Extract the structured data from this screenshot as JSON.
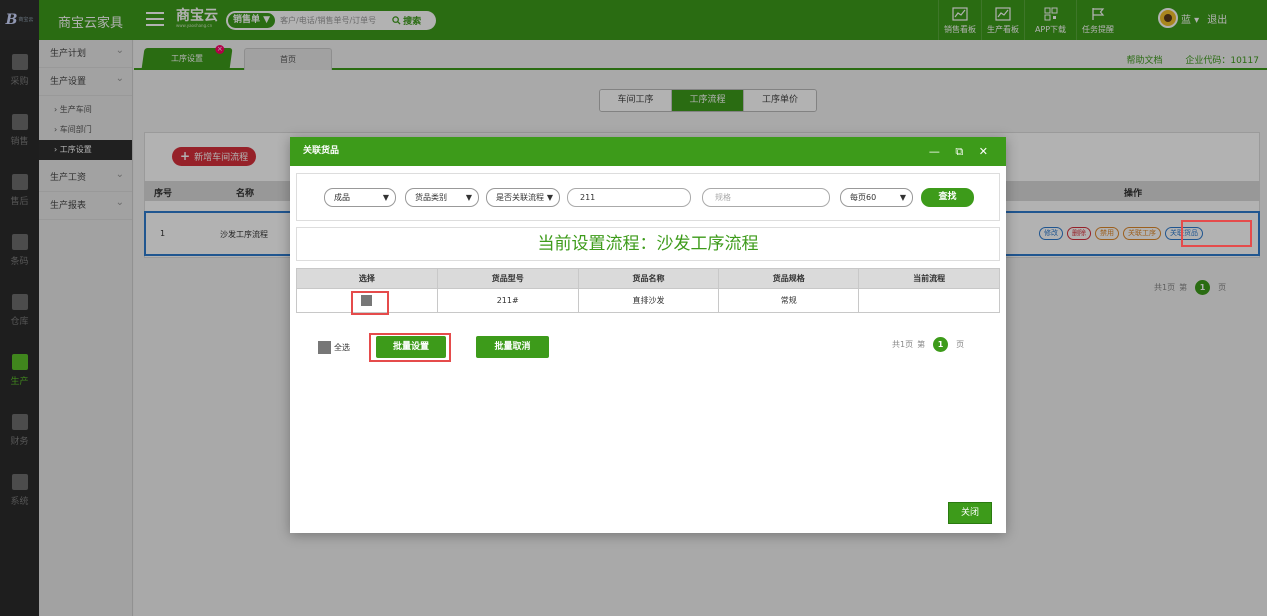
{
  "topbar": {
    "logo_text": "B",
    "logo_subtext": "商宝云",
    "app_title": "商宝云家具",
    "brand": "商宝云",
    "brand_sub": "www.yaoshang.cn",
    "search_type": "销售单 ▼",
    "search_placeholder": "客户/电话/销售单号/订单号",
    "search_button": "搜索",
    "tools": [
      {
        "label": "销售看板",
        "icon": "chart-icon"
      },
      {
        "label": "生产看板",
        "icon": "chart-icon"
      },
      {
        "label": "APP下载",
        "icon": "qrcode-icon"
      },
      {
        "label": "任务提醒",
        "icon": "flag-icon"
      }
    ],
    "user_name": "蓝 ▾",
    "logout": "退出"
  },
  "dark_nav": [
    {
      "label": "采购"
    },
    {
      "label": "销售"
    },
    {
      "label": "售后"
    },
    {
      "label": "条码"
    },
    {
      "label": "仓库"
    },
    {
      "label": "生产",
      "active": true
    },
    {
      "label": "财务"
    },
    {
      "label": "系统"
    }
  ],
  "submenu": {
    "group1": "生产计划",
    "group2": "生产设置",
    "items": [
      "› 生产车间",
      "› 车间部门",
      "› 工序设置"
    ],
    "group3": "生产工资",
    "group4": "生产报表"
  },
  "tabs": {
    "active": "工序设置",
    "close": "×",
    "inactive": "首页"
  },
  "help": {
    "doc": "帮助文档",
    "company": "企业代码：10117"
  },
  "segments": [
    "车间工序",
    "工序流程",
    "工序单价"
  ],
  "add_button": "新增车间流程",
  "main_table": {
    "headers": [
      "序号",
      "名称",
      "操作"
    ],
    "row": {
      "index": "1",
      "name": "沙发工序流程"
    },
    "ops": [
      "修改",
      "删除",
      "禁用",
      "关联工序",
      "关联货品"
    ]
  },
  "main_pager": {
    "total": "共1页",
    "prefix": "第",
    "page": "1",
    "suffix": "页"
  },
  "modal": {
    "title": "关联货品",
    "header_icons": "— ⧉ ✕",
    "filters": {
      "category": "成品",
      "type": "货品类别",
      "linked": "是否关联流程",
      "keyword": "211",
      "spec_placeholder": "规格",
      "page_size": "每页60",
      "find": "查找"
    },
    "flow_title": "当前设置流程：沙发工序流程",
    "table_headers": [
      "选择",
      "货品型号",
      "货品名称",
      "货品规格",
      "当前流程"
    ],
    "rows": [
      {
        "model": "211#",
        "name": "直排沙发",
        "spec": "常规",
        "flow": ""
      }
    ],
    "select_all": "全选",
    "batch_set": "批量设置",
    "batch_cancel": "批量取消",
    "pager": {
      "total": "共1页",
      "prefix": "第",
      "page": "1",
      "suffix": "页"
    },
    "close": "关闭"
  },
  "colors": {
    "primary": "#3d9b1a",
    "dark": "#2b2b2b",
    "highlight": "#e54b4b",
    "danger": "#d7303b"
  }
}
